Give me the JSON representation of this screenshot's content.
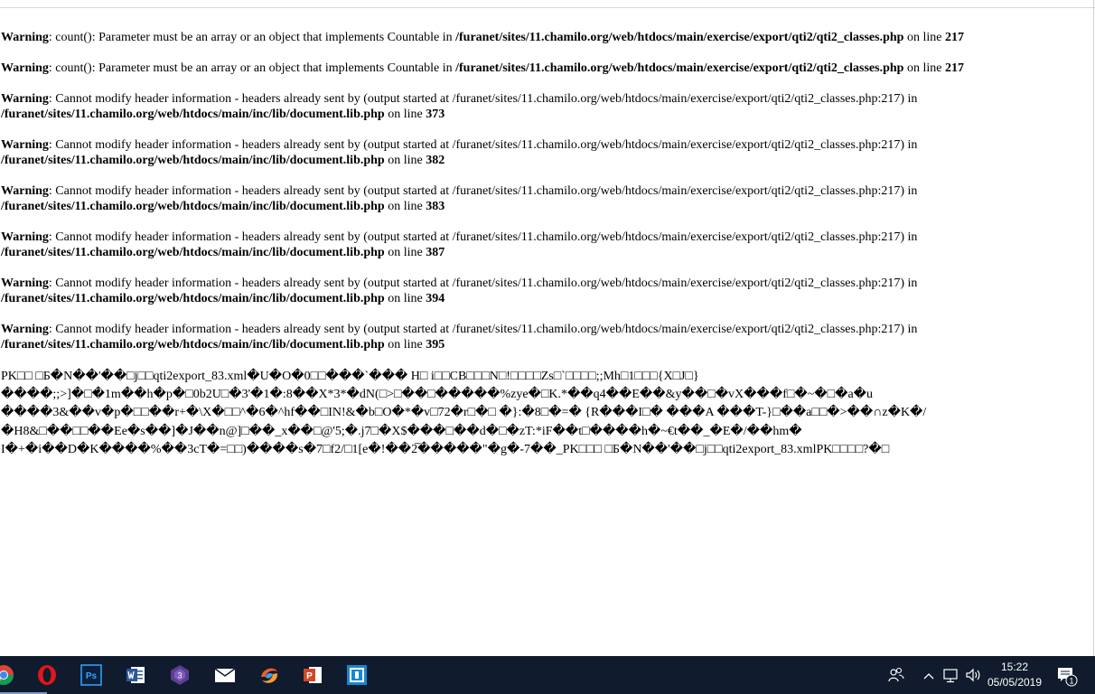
{
  "warnings": [
    {
      "label": "Warning",
      "a": ": count(): Parameter must be an array or an object that implements Countable in ",
      "file": "/furanet/sites/11.chamilo.org/web/htdocs/main/exercise/export/qti2/qti2_classes.php",
      "b": " on line ",
      "line": "217"
    },
    {
      "label": "Warning",
      "a": ": count(): Parameter must be an array or an object that implements Countable in ",
      "file": "/furanet/sites/11.chamilo.org/web/htdocs/main/exercise/export/qti2/qti2_classes.php",
      "b": " on line ",
      "line": "217"
    },
    {
      "label": "Warning",
      "a": ": Cannot modify header information - headers already sent by (output started at /furanet/sites/11.chamilo.org/web/htdocs/main/exercise/export/qti2/qti2_classes.php:217) in",
      "file": "/furanet/sites/11.chamilo.org/web/htdocs/main/inc/lib/document.lib.php",
      "b": " on line ",
      "line": "373"
    },
    {
      "label": "Warning",
      "a": ": Cannot modify header information - headers already sent by (output started at /furanet/sites/11.chamilo.org/web/htdocs/main/exercise/export/qti2/qti2_classes.php:217) in",
      "file": "/furanet/sites/11.chamilo.org/web/htdocs/main/inc/lib/document.lib.php",
      "b": " on line ",
      "line": "382"
    },
    {
      "label": "Warning",
      "a": ": Cannot modify header information - headers already sent by (output started at /furanet/sites/11.chamilo.org/web/htdocs/main/exercise/export/qti2/qti2_classes.php:217) in",
      "file": "/furanet/sites/11.chamilo.org/web/htdocs/main/inc/lib/document.lib.php",
      "b": " on line ",
      "line": "383"
    },
    {
      "label": "Warning",
      "a": ": Cannot modify header information - headers already sent by (output started at /furanet/sites/11.chamilo.org/web/htdocs/main/exercise/export/qti2/qti2_classes.php:217) in",
      "file": "/furanet/sites/11.chamilo.org/web/htdocs/main/inc/lib/document.lib.php",
      "b": " on line ",
      "line": "387"
    },
    {
      "label": "Warning",
      "a": ": Cannot modify header information - headers already sent by (output started at /furanet/sites/11.chamilo.org/web/htdocs/main/exercise/export/qti2/qti2_classes.php:217) in",
      "file": "/furanet/sites/11.chamilo.org/web/htdocs/main/inc/lib/document.lib.php",
      "b": " on line ",
      "line": "394"
    },
    {
      "label": "Warning",
      "a": ": Cannot modify header information - headers already sent by (output started at /furanet/sites/11.chamilo.org/web/htdocs/main/exercise/export/qti2/qti2_classes.php:217) in",
      "file": "/furanet/sites/11.chamilo.org/web/htdocs/main/inc/lib/document.lib.php",
      "b": " on line ",
      "line": "395"
    }
  ],
  "garbage_lines": [
    "PK□□ □Б�N��'��□j□□qti2export_83.xml�U�O�0□□���`��� H□ i□□CB□□□N□!□□□□Zs□`□□□□;;Mh□1□□□{X□J□}",
    "����;;>]�□�1m��h�p�□0b2U□�3'�1�:8��X*3*�dN(□>□��□�����%zye�□K.*��q4��E��&y��□�vX���f□�~�□�a�u",
    "����3&��v�p�□□��r+�\\X�□□^�6�^hf��□IN!&�b□O�*�v□72�r□�□ �}:�8□�=� {R���I□� ���A  ���T-}□��a□□�>��∩z�K�/",
    "�H8&□��□□��Ee�ѕ��]�J��n@]□��_x��□@'5;�.j7□�X$���□��d�□�zT:*iF��t□����h�~€t��_�E�/��hm�",
    "I�+�i��D�K����%��3cT�=□□)����s�7□f2/□1[e�!��2̅�����\"�g�-7��_PK□□□ □Б�N��'��□j□□qti2export_83.xmlPK□□□□?�□"
  ],
  "taskbar": {
    "apps": [
      {
        "name": "chrome-icon"
      },
      {
        "name": "opera-icon"
      },
      {
        "name": "photoshop-icon",
        "text": "Ps"
      },
      {
        "name": "word-icon"
      },
      {
        "name": "app-icon"
      },
      {
        "name": "mail-icon"
      },
      {
        "name": "swirl-icon"
      },
      {
        "name": "powerpoint-icon",
        "text": "P"
      },
      {
        "name": "app-window-icon"
      }
    ],
    "clock": {
      "time": "15:22",
      "date": "05/05/2019"
    },
    "notification_count": "1"
  },
  "colors": {
    "taskbar": "#101b2d",
    "opera": "#e0161b",
    "photoshop": "#0c1f3d",
    "word": "#2b579a",
    "powerpoint": "#d24726"
  }
}
